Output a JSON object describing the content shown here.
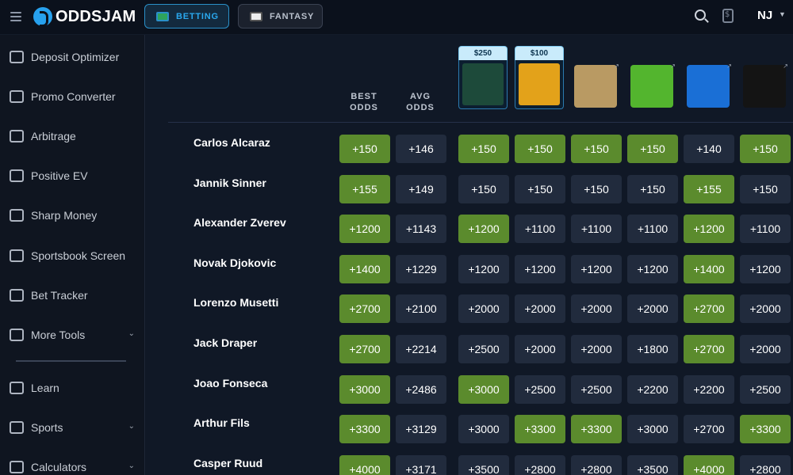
{
  "header": {
    "brand": "ODDSJAM",
    "nav": [
      {
        "label": "BETTING",
        "active": true
      },
      {
        "label": "FANTASY",
        "active": false
      }
    ],
    "state": "NJ"
  },
  "sidebar": {
    "items": [
      {
        "label": "Deposit Optimizer",
        "icon": "deposit-icon",
        "has_chevron": false
      },
      {
        "label": "Promo Converter",
        "icon": "refresh-dollar-icon",
        "has_chevron": false
      },
      {
        "label": "Arbitrage",
        "icon": "magnifier-dollar-icon",
        "has_chevron": false
      },
      {
        "label": "Positive EV",
        "icon": "coins-icon",
        "has_chevron": false
      },
      {
        "label": "Sharp Money",
        "icon": "money-bag-icon",
        "has_chevron": false
      },
      {
        "label": "Sportsbook Screen",
        "icon": "grid-icon",
        "has_chevron": false
      },
      {
        "label": "Bet Tracker",
        "icon": "bar-chart-icon",
        "has_chevron": false
      },
      {
        "label": "More Tools",
        "icon": "tools-icon",
        "has_chevron": true
      },
      {
        "label": "Learn",
        "icon": "graduation-cap-icon",
        "has_chevron": false
      },
      {
        "label": "Sports",
        "icon": "trophy-icon",
        "has_chevron": true
      },
      {
        "label": "Calculators",
        "icon": "calculator-icon",
        "has_chevron": true
      }
    ]
  },
  "table": {
    "columns": {
      "best": "BEST\nODDS",
      "avg": "AVG\nODDS"
    },
    "books": [
      {
        "name": "trophy-book",
        "bonus": "$250",
        "color": "#1d4a3a"
      },
      {
        "name": "betparx-book",
        "bonus": "$100",
        "color": "#e3a21a"
      },
      {
        "name": "betmgm-lion-book",
        "bonus": "",
        "color": "#b99a63"
      },
      {
        "name": "draftkings-book",
        "bonus": "",
        "color": "#53b52e"
      },
      {
        "name": "fanduel-book",
        "bonus": "",
        "color": "#1a6fd6"
      },
      {
        "name": "pointsbet-book",
        "bonus": "",
        "color": "#141414"
      }
    ],
    "rows": [
      {
        "name": "Carlos Alcaraz",
        "best": "+150",
        "avg": "+146",
        "odds": [
          "+150",
          "+150",
          "+150",
          "+150",
          "+140",
          "+150"
        ],
        "win": [
          true,
          true,
          true,
          true,
          false,
          true
        ]
      },
      {
        "name": "Jannik Sinner",
        "best": "+155",
        "avg": "+149",
        "odds": [
          "+150",
          "+150",
          "+150",
          "+150",
          "+155",
          "+150"
        ],
        "win": [
          false,
          false,
          false,
          false,
          true,
          false
        ]
      },
      {
        "name": "Alexander Zverev",
        "best": "+1200",
        "avg": "+1143",
        "odds": [
          "+1200",
          "+1100",
          "+1100",
          "+1100",
          "+1200",
          "+1100"
        ],
        "win": [
          true,
          false,
          false,
          false,
          true,
          false
        ]
      },
      {
        "name": "Novak Djokovic",
        "best": "+1400",
        "avg": "+1229",
        "odds": [
          "+1200",
          "+1200",
          "+1200",
          "+1200",
          "+1400",
          "+1200"
        ],
        "win": [
          false,
          false,
          false,
          false,
          true,
          false
        ]
      },
      {
        "name": "Lorenzo Musetti",
        "best": "+2700",
        "avg": "+2100",
        "odds": [
          "+2000",
          "+2000",
          "+2000",
          "+2000",
          "+2700",
          "+2000"
        ],
        "win": [
          false,
          false,
          false,
          false,
          true,
          false
        ]
      },
      {
        "name": "Jack Draper",
        "best": "+2700",
        "avg": "+2214",
        "odds": [
          "+2500",
          "+2000",
          "+2000",
          "+1800",
          "+2700",
          "+2000"
        ],
        "win": [
          false,
          false,
          false,
          false,
          true,
          false
        ]
      },
      {
        "name": "Joao Fonseca",
        "best": "+3000",
        "avg": "+2486",
        "odds": [
          "+3000",
          "+2500",
          "+2500",
          "+2200",
          "+2200",
          "+2500"
        ],
        "win": [
          true,
          false,
          false,
          false,
          false,
          false
        ]
      },
      {
        "name": "Arthur Fils",
        "best": "+3300",
        "avg": "+3129",
        "odds": [
          "+3000",
          "+3300",
          "+3300",
          "+3000",
          "+2700",
          "+3300"
        ],
        "win": [
          false,
          true,
          true,
          false,
          false,
          true
        ]
      },
      {
        "name": "Casper Ruud",
        "best": "+4000",
        "avg": "+3171",
        "odds": [
          "+3500",
          "+2800",
          "+2800",
          "+3500",
          "+4000",
          "+2800"
        ],
        "win": [
          false,
          false,
          false,
          false,
          true,
          false
        ]
      }
    ]
  }
}
